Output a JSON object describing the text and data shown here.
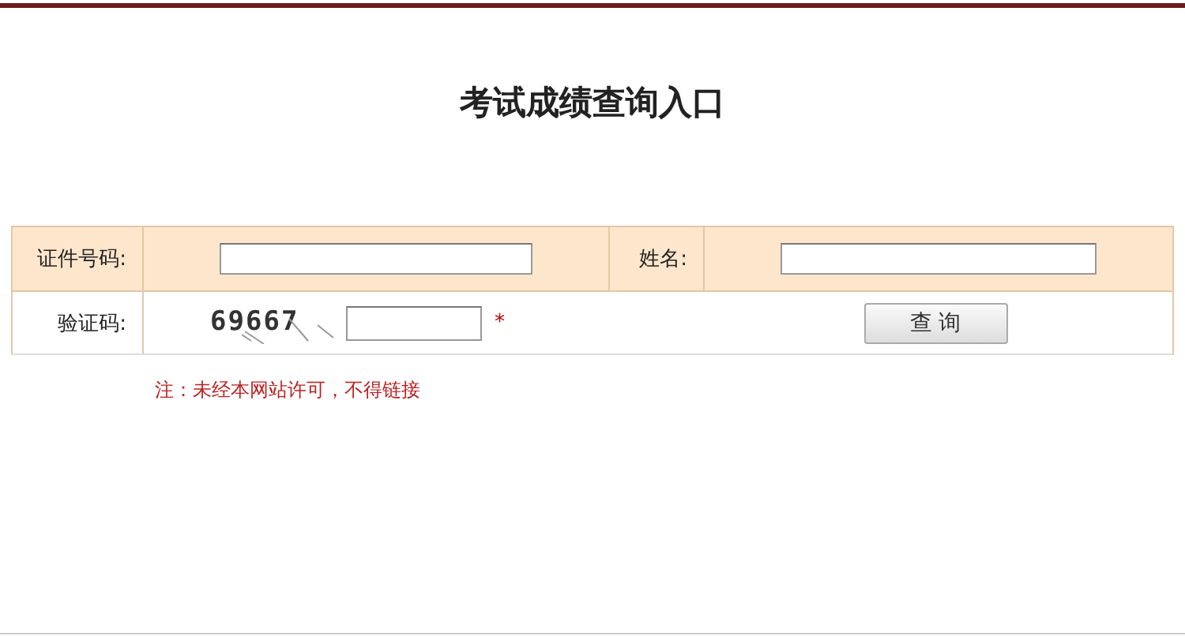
{
  "title": "考试成绩查询入口",
  "fields": [
    {
      "label": "证件号码:"
    },
    {
      "label": "姓名:"
    }
  ],
  "captcha_row": {
    "label": "验证码:",
    "captcha": "69667",
    "required_mark": "*"
  },
  "submit": "查 询",
  "note": "注：未经本网站许可，不得链接"
}
